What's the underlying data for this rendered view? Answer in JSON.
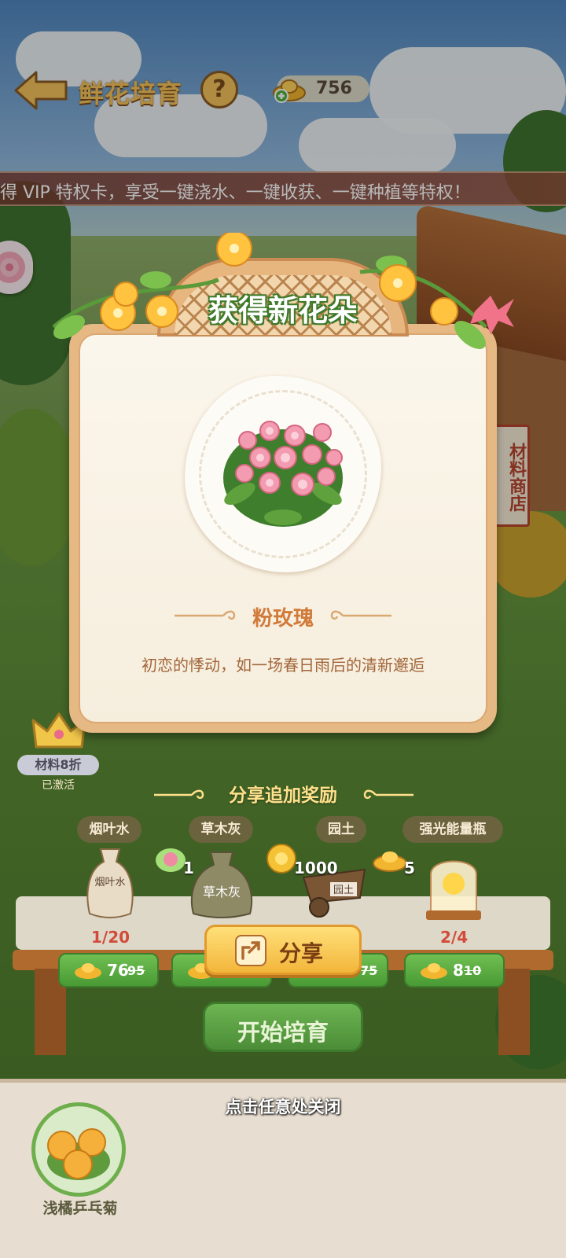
{
  "header": {
    "title": "鲜花培育",
    "help_label": "?",
    "currency_value": "756"
  },
  "marquee": {
    "text": "得 VIP 特权卡，享受一键浇水、一键收获、一键种植等特权！"
  },
  "modal": {
    "title": "获得新花朵",
    "flower_name": "粉玫瑰",
    "flower_desc": "初恋的悸动，如一场春日雨后的清新邂逅"
  },
  "shop_sign": "材料商店",
  "vip": {
    "label": "材料8折",
    "status": "已激活"
  },
  "share_section": {
    "heading": "分享追加奖励",
    "rewards": [
      {
        "icon": "rose-seed-icon",
        "value": "1"
      },
      {
        "icon": "gold-coin-icon",
        "value": "1000"
      },
      {
        "icon": "gold-ingot-icon",
        "value": "5"
      }
    ],
    "share_label": "分享"
  },
  "materials": [
    {
      "name": "烟叶水",
      "sack_text": "烟叶水",
      "progress": "1/20",
      "price": "76",
      "old_price": "95"
    },
    {
      "name": "草木灰",
      "sack_text": "草木灰",
      "progress": "",
      "price": "",
      "old_price": ""
    },
    {
      "name": "园土",
      "sack_text": "园土",
      "progress": "",
      "price": "",
      "old_price": "75"
    },
    {
      "name": "强光能量瓶",
      "sack_text": "",
      "progress": "2/4",
      "price": "8",
      "old_price": "10"
    }
  ],
  "start_label": "开始培育",
  "close_hint": "点击任意处关闭",
  "seed": {
    "name": "浅橘乒乓菊"
  },
  "colors": {
    "title_green": "#3e7a2a",
    "accent_orange": "#d17a3a",
    "button_green": "#4b8d37",
    "share_yellow": "#f2b53a"
  }
}
